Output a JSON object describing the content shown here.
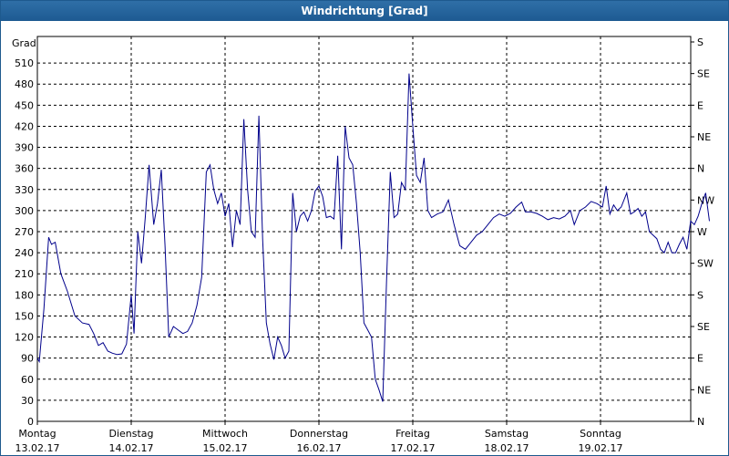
{
  "window": {
    "title": "Windrichtung [Grad]"
  },
  "chart_data": {
    "type": "line",
    "ylabel": "Grad",
    "ylim": [
      0,
      540
    ],
    "yticks": [
      0,
      30,
      60,
      90,
      120,
      150,
      180,
      210,
      240,
      270,
      300,
      330,
      360,
      390,
      420,
      450,
      480,
      510
    ],
    "right_axis_labels": [
      {
        "value": 0,
        "label": "N"
      },
      {
        "value": 45,
        "label": "NE"
      },
      {
        "value": 90,
        "label": "E"
      },
      {
        "value": 135,
        "label": "SE"
      },
      {
        "value": 180,
        "label": "S"
      },
      {
        "value": 225,
        "label": "SW"
      },
      {
        "value": 270,
        "label": "W"
      },
      {
        "value": 315,
        "label": "NW"
      },
      {
        "value": 360,
        "label": "N"
      },
      {
        "value": 405,
        "label": "NE"
      },
      {
        "value": 450,
        "label": "E"
      },
      {
        "value": 495,
        "label": "SE"
      },
      {
        "value": 540,
        "label": "S"
      }
    ],
    "days": [
      {
        "day": "Montag",
        "date": "13.02.17"
      },
      {
        "day": "Dienstag",
        "date": "14.02.17"
      },
      {
        "day": "Mittwoch",
        "date": "15.02.17"
      },
      {
        "day": "Donnerstag",
        "date": "16.02.17"
      },
      {
        "day": "Freitag",
        "date": "17.02.17"
      },
      {
        "day": "Samstag",
        "date": "18.02.17"
      },
      {
        "day": "Sonntag",
        "date": "19.02.17"
      }
    ],
    "xlim": [
      0,
      7
    ],
    "grid": true,
    "series": [
      {
        "color": "#00008b",
        "points": [
          [
            0.0,
            90
          ],
          [
            0.02,
            85
          ],
          [
            0.07,
            160
          ],
          [
            0.12,
            262
          ],
          [
            0.15,
            252
          ],
          [
            0.19,
            255
          ],
          [
            0.25,
            210
          ],
          [
            0.32,
            185
          ],
          [
            0.4,
            150
          ],
          [
            0.48,
            140
          ],
          [
            0.55,
            138
          ],
          [
            0.6,
            125
          ],
          [
            0.65,
            108
          ],
          [
            0.7,
            112
          ],
          [
            0.75,
            100
          ],
          [
            0.8,
            97
          ],
          [
            0.85,
            95
          ],
          [
            0.9,
            96
          ],
          [
            0.95,
            110
          ],
          [
            1.0,
            180
          ],
          [
            1.03,
            125
          ],
          [
            1.07,
            270
          ],
          [
            1.11,
            225
          ],
          [
            1.15,
            290
          ],
          [
            1.19,
            365
          ],
          [
            1.24,
            280
          ],
          [
            1.28,
            310
          ],
          [
            1.32,
            358
          ],
          [
            1.36,
            250
          ],
          [
            1.4,
            120
          ],
          [
            1.45,
            135
          ],
          [
            1.5,
            130
          ],
          [
            1.55,
            125
          ],
          [
            1.6,
            128
          ],
          [
            1.65,
            140
          ],
          [
            1.7,
            165
          ],
          [
            1.75,
            205
          ],
          [
            1.8,
            355
          ],
          [
            1.84,
            365
          ],
          [
            1.88,
            330
          ],
          [
            1.92,
            310
          ],
          [
            1.96,
            325
          ],
          [
            2.0,
            292
          ],
          [
            2.04,
            310
          ],
          [
            2.08,
            248
          ],
          [
            2.12,
            300
          ],
          [
            2.16,
            280
          ],
          [
            2.2,
            430
          ],
          [
            2.24,
            330
          ],
          [
            2.28,
            270
          ],
          [
            2.32,
            262
          ],
          [
            2.36,
            435
          ],
          [
            2.4,
            260
          ],
          [
            2.44,
            140
          ],
          [
            2.48,
            110
          ],
          [
            2.52,
            88
          ],
          [
            2.56,
            120
          ],
          [
            2.6,
            108
          ],
          [
            2.64,
            90
          ],
          [
            2.68,
            100
          ],
          [
            2.72,
            325
          ],
          [
            2.76,
            270
          ],
          [
            2.8,
            292
          ],
          [
            2.84,
            298
          ],
          [
            2.88,
            285
          ],
          [
            2.92,
            300
          ],
          [
            2.96,
            328
          ],
          [
            3.0,
            335
          ],
          [
            3.04,
            320
          ],
          [
            3.08,
            290
          ],
          [
            3.12,
            292
          ],
          [
            3.16,
            288
          ],
          [
            3.2,
            378
          ],
          [
            3.24,
            245
          ],
          [
            3.28,
            420
          ],
          [
            3.32,
            375
          ],
          [
            3.36,
            365
          ],
          [
            3.4,
            310
          ],
          [
            3.44,
            240
          ],
          [
            3.48,
            140
          ],
          [
            3.52,
            130
          ],
          [
            3.56,
            120
          ],
          [
            3.6,
            60
          ],
          [
            3.64,
            45
          ],
          [
            3.68,
            28
          ],
          [
            3.72,
            200
          ],
          [
            3.76,
            355
          ],
          [
            3.8,
            290
          ],
          [
            3.84,
            295
          ],
          [
            3.88,
            340
          ],
          [
            3.92,
            330
          ],
          [
            3.96,
            495
          ],
          [
            4.0,
            420
          ],
          [
            4.04,
            350
          ],
          [
            4.08,
            340
          ],
          [
            4.12,
            375
          ],
          [
            4.16,
            300
          ],
          [
            4.2,
            290
          ],
          [
            4.26,
            295
          ],
          [
            4.32,
            298
          ],
          [
            4.38,
            315
          ],
          [
            4.44,
            280
          ],
          [
            4.5,
            250
          ],
          [
            4.56,
            245
          ],
          [
            4.62,
            255
          ],
          [
            4.68,
            265
          ],
          [
            4.74,
            270
          ],
          [
            4.8,
            280
          ],
          [
            4.86,
            290
          ],
          [
            4.92,
            295
          ],
          [
            4.98,
            292
          ],
          [
            5.04,
            296
          ],
          [
            5.1,
            305
          ],
          [
            5.16,
            312
          ],
          [
            5.2,
            298
          ],
          [
            5.26,
            298
          ],
          [
            5.32,
            296
          ],
          [
            5.38,
            292
          ],
          [
            5.44,
            287
          ],
          [
            5.5,
            290
          ],
          [
            5.56,
            288
          ],
          [
            5.62,
            292
          ],
          [
            5.68,
            300
          ],
          [
            5.72,
            280
          ],
          [
            5.78,
            300
          ],
          [
            5.84,
            305
          ],
          [
            5.9,
            313
          ],
          [
            5.96,
            310
          ],
          [
            6.02,
            305
          ],
          [
            6.06,
            335
          ],
          [
            6.1,
            295
          ],
          [
            6.14,
            308
          ],
          [
            6.18,
            300
          ],
          [
            6.22,
            305
          ],
          [
            6.28,
            325
          ],
          [
            6.32,
            295
          ],
          [
            6.36,
            298
          ],
          [
            6.4,
            303
          ],
          [
            6.44,
            292
          ],
          [
            6.48,
            298
          ],
          [
            6.52,
            270
          ],
          [
            6.56,
            265
          ],
          [
            6.6,
            260
          ],
          [
            6.64,
            245
          ],
          [
            6.68,
            240
          ],
          [
            6.72,
            255
          ],
          [
            6.76,
            240
          ],
          [
            6.8,
            240
          ],
          [
            6.84,
            252
          ],
          [
            6.88,
            262
          ],
          [
            6.92,
            245
          ],
          [
            6.96,
            285
          ],
          [
            7.0,
            280
          ],
          [
            7.04,
            292
          ],
          [
            7.08,
            310
          ],
          [
            7.12,
            325
          ],
          [
            7.16,
            285
          ]
        ]
      }
    ]
  }
}
